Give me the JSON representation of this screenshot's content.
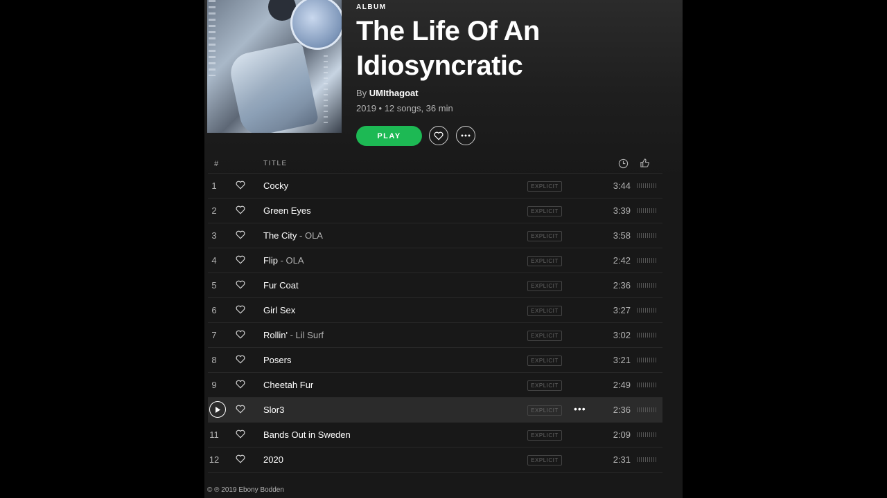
{
  "album": {
    "kind": "ALBUM",
    "title": "The Life Of An Idiosyncratic",
    "by_prefix": "By",
    "artist": "UMIthagoat",
    "info": "2019 • 12 songs, 36 min",
    "play_label": "PLAY",
    "cover_icon": "album-cover-art"
  },
  "header": {
    "number": "#",
    "title": "TITLE",
    "duration_icon": "clock-icon",
    "popularity_icon": "thumbs-up-icon"
  },
  "tracks": [
    {
      "num": "1",
      "title": "Cocky",
      "feat": "",
      "explicit": "EXPLICIT",
      "duration": "3:44"
    },
    {
      "num": "2",
      "title": "Green Eyes",
      "feat": "",
      "explicit": "EXPLICIT",
      "duration": "3:39"
    },
    {
      "num": "3",
      "title": "The City",
      "feat": " - OLA",
      "explicit": "EXPLICIT",
      "duration": "3:58"
    },
    {
      "num": "4",
      "title": "Flip",
      "feat": " - OLA",
      "explicit": "EXPLICIT",
      "duration": "2:42"
    },
    {
      "num": "5",
      "title": "Fur Coat",
      "feat": "",
      "explicit": "EXPLICIT",
      "duration": "2:36"
    },
    {
      "num": "6",
      "title": "Girl Sex",
      "feat": "",
      "explicit": "EXPLICIT",
      "duration": "3:27"
    },
    {
      "num": "7",
      "title": "Rollin'",
      "feat": " - Lil Surf",
      "explicit": "EXPLICIT",
      "duration": "3:02"
    },
    {
      "num": "8",
      "title": "Posers",
      "feat": "",
      "explicit": "EXPLICIT",
      "duration": "3:21"
    },
    {
      "num": "9",
      "title": "Cheetah Fur",
      "feat": "",
      "explicit": "EXPLICIT",
      "duration": "2:49"
    },
    {
      "num": "",
      "title": "Slor3",
      "feat": "",
      "explicit": "EXPLICIT",
      "duration": "2:36",
      "hover": true
    },
    {
      "num": "11",
      "title": "Bands Out in Sweden",
      "feat": "",
      "explicit": "EXPLICIT",
      "duration": "2:09"
    },
    {
      "num": "12",
      "title": "2020",
      "feat": "",
      "explicit": "EXPLICIT",
      "duration": "2:31"
    }
  ],
  "copyright": "© ℗ 2019 Ebony Bodden",
  "colors": {
    "accent": "#1db954",
    "background": "#181818"
  }
}
